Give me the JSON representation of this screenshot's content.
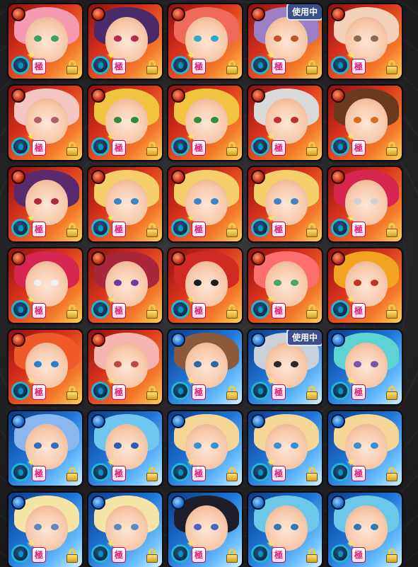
{
  "badge_text": "使用中",
  "kiwami_text": "極",
  "cards": [
    {
      "element": "fire",
      "hair": "#f59ab0",
      "eye": "#3a9e65",
      "in_use": false
    },
    {
      "element": "fire",
      "hair": "#4a2a68",
      "eye": "#b22d4f",
      "in_use": false
    },
    {
      "element": "fire",
      "hair": "#ef6a5a",
      "eye": "#2ea8c9",
      "in_use": false
    },
    {
      "element": "fire",
      "hair": "#9c7fc4",
      "eye": "#c0532e",
      "in_use": true
    },
    {
      "element": "fire",
      "hair": "#f3d1b8",
      "eye": "#8d6b4f",
      "in_use": false
    },
    {
      "element": "fire",
      "hair": "#f3c6c2",
      "eye": "#b15f6b",
      "in_use": false
    },
    {
      "element": "fire",
      "hair": "#f1c43f",
      "eye": "#2f8d3a",
      "in_use": false
    },
    {
      "element": "fire",
      "hair": "#f1c43f",
      "eye": "#2f8d3a",
      "in_use": false
    },
    {
      "element": "fire",
      "hair": "#d9d9d9",
      "eye": "#c03030",
      "in_use": false
    },
    {
      "element": "fire",
      "hair": "#6a3a1e",
      "eye": "#d66b1a",
      "in_use": false
    },
    {
      "element": "fire",
      "hair": "#5a2a6e",
      "eye": "#b02a3e",
      "in_use": false
    },
    {
      "element": "fire",
      "hair": "#f5cf6a",
      "eye": "#3b84c9",
      "in_use": false
    },
    {
      "element": "fire",
      "hair": "#f5cf6a",
      "eye": "#3b84c9",
      "in_use": false
    },
    {
      "element": "fire",
      "hair": "#f5cf6a",
      "eye": "#3b84c9",
      "in_use": false
    },
    {
      "element": "fire",
      "hair": "#d6264f",
      "eye": "#d1d1d1",
      "in_use": false
    },
    {
      "element": "fire",
      "hair": "#d6264f",
      "eye": "#f0f0f0",
      "in_use": false
    },
    {
      "element": "fire",
      "hair": "#a8283a",
      "eye": "#6e3d9b",
      "in_use": false
    },
    {
      "element": "fire",
      "hair": "#d12a23",
      "eye": "#1c1c1c",
      "in_use": false
    },
    {
      "element": "fire",
      "hair": "#ff6e6e",
      "eye": "#4aa565",
      "in_use": false
    },
    {
      "element": "fire",
      "hair": "#f2a320",
      "eye": "#c1311f",
      "in_use": false
    },
    {
      "element": "fire",
      "hair": "#ee5a2a",
      "eye": "#2a7ed0",
      "in_use": false
    },
    {
      "element": "fire",
      "hair": "#f7b5b0",
      "eye": "#b84a40",
      "in_use": false
    },
    {
      "element": "water",
      "hair": "#8a5a3a",
      "eye": "#2b6aa8",
      "in_use": false
    },
    {
      "element": "water",
      "hair": "#c9d1da",
      "eye": "#2a2a2a",
      "in_use": true
    },
    {
      "element": "water",
      "hair": "#5fd3d3",
      "eye": "#7a52b4",
      "in_use": false
    },
    {
      "element": "water",
      "hair": "#8ab7ee",
      "eye": "#2e6fc0",
      "in_use": false
    },
    {
      "element": "water",
      "hair": "#6fc7f0",
      "eye": "#2b5fae",
      "in_use": false
    },
    {
      "element": "water",
      "hair": "#f6d696",
      "eye": "#3490d0",
      "in_use": false
    },
    {
      "element": "water",
      "hair": "#f6d696",
      "eye": "#3490d0",
      "in_use": false
    },
    {
      "element": "water",
      "hair": "#f6d696",
      "eye": "#3490d0",
      "in_use": false
    },
    {
      "element": "water",
      "hair": "#f6e3a6",
      "eye": "#5a8ac0",
      "in_use": false
    },
    {
      "element": "water",
      "hair": "#f6e3a6",
      "eye": "#5a8ac0",
      "in_use": false
    },
    {
      "element": "water",
      "hair": "#1e1e2a",
      "eye": "#4a62c8",
      "in_use": false
    },
    {
      "element": "water",
      "hair": "#6cc8e8",
      "eye": "#2c7ab8",
      "in_use": false
    },
    {
      "element": "water",
      "hair": "#6cc8e8",
      "eye": "#2c7ab8",
      "in_use": false
    }
  ]
}
